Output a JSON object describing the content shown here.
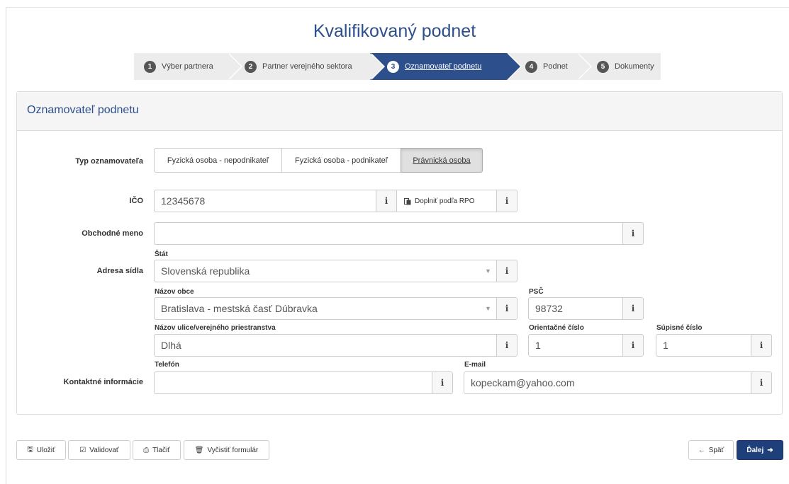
{
  "title": "Kvalifikovaný podnet",
  "steps": [
    {
      "num": "1",
      "label": "Výber partnera"
    },
    {
      "num": "2",
      "label": "Partner verejného sektora"
    },
    {
      "num": "3",
      "label": "Oznamovateľ podnetu"
    },
    {
      "num": "4",
      "label": "Podnet"
    },
    {
      "num": "5",
      "label": "Dokumenty"
    }
  ],
  "panel": {
    "heading": "Oznamovateľ podnetu"
  },
  "form": {
    "typ_label": "Typ oznamovateľa",
    "typ_options": [
      "Fyzická osoba - nepodnikateľ",
      "Fyzická osoba - podnikateľ",
      "Právnická osoba"
    ],
    "ico_label": "IČO",
    "ico_value": "12345678",
    "rpo_button": "Doplniť podľa RPO",
    "obchodne_meno_label": "Obchodné meno",
    "obchodne_meno_value": "",
    "adresa_label": "Adresa sídla",
    "stat_label": "Štát",
    "stat_value": "Slovenská republika",
    "obec_label": "Názov obce",
    "obec_value": "Bratislava - mestská časť Dúbravka",
    "psc_label": "PSČ",
    "psc_value": "98732",
    "ulica_label": "Názov ulice/verejného priestranstva",
    "ulica_value": "Dlhá",
    "orientacne_label": "Orientačné číslo",
    "orientacne_value": "1",
    "supisne_label": "Súpisné číslo",
    "supisne_value": "1",
    "kontakt_label": "Kontaktné informácie",
    "telefon_label": "Telefón",
    "telefon_value": "",
    "email_label": "E-mail",
    "email_value": "kopeckam@yahoo.com",
    "info_glyph": "i",
    "caret_glyph": "▼"
  },
  "footer": {
    "ulozit": "Uložiť",
    "validovat": "Validovať",
    "tlacit": "Tlačiť",
    "vycistit": "Vyčistiť formulár",
    "spat": "Späť",
    "dalej": "Ďalej"
  },
  "colors": {
    "accent": "#2d4f8c",
    "primary_button": "#1f3f7a"
  }
}
